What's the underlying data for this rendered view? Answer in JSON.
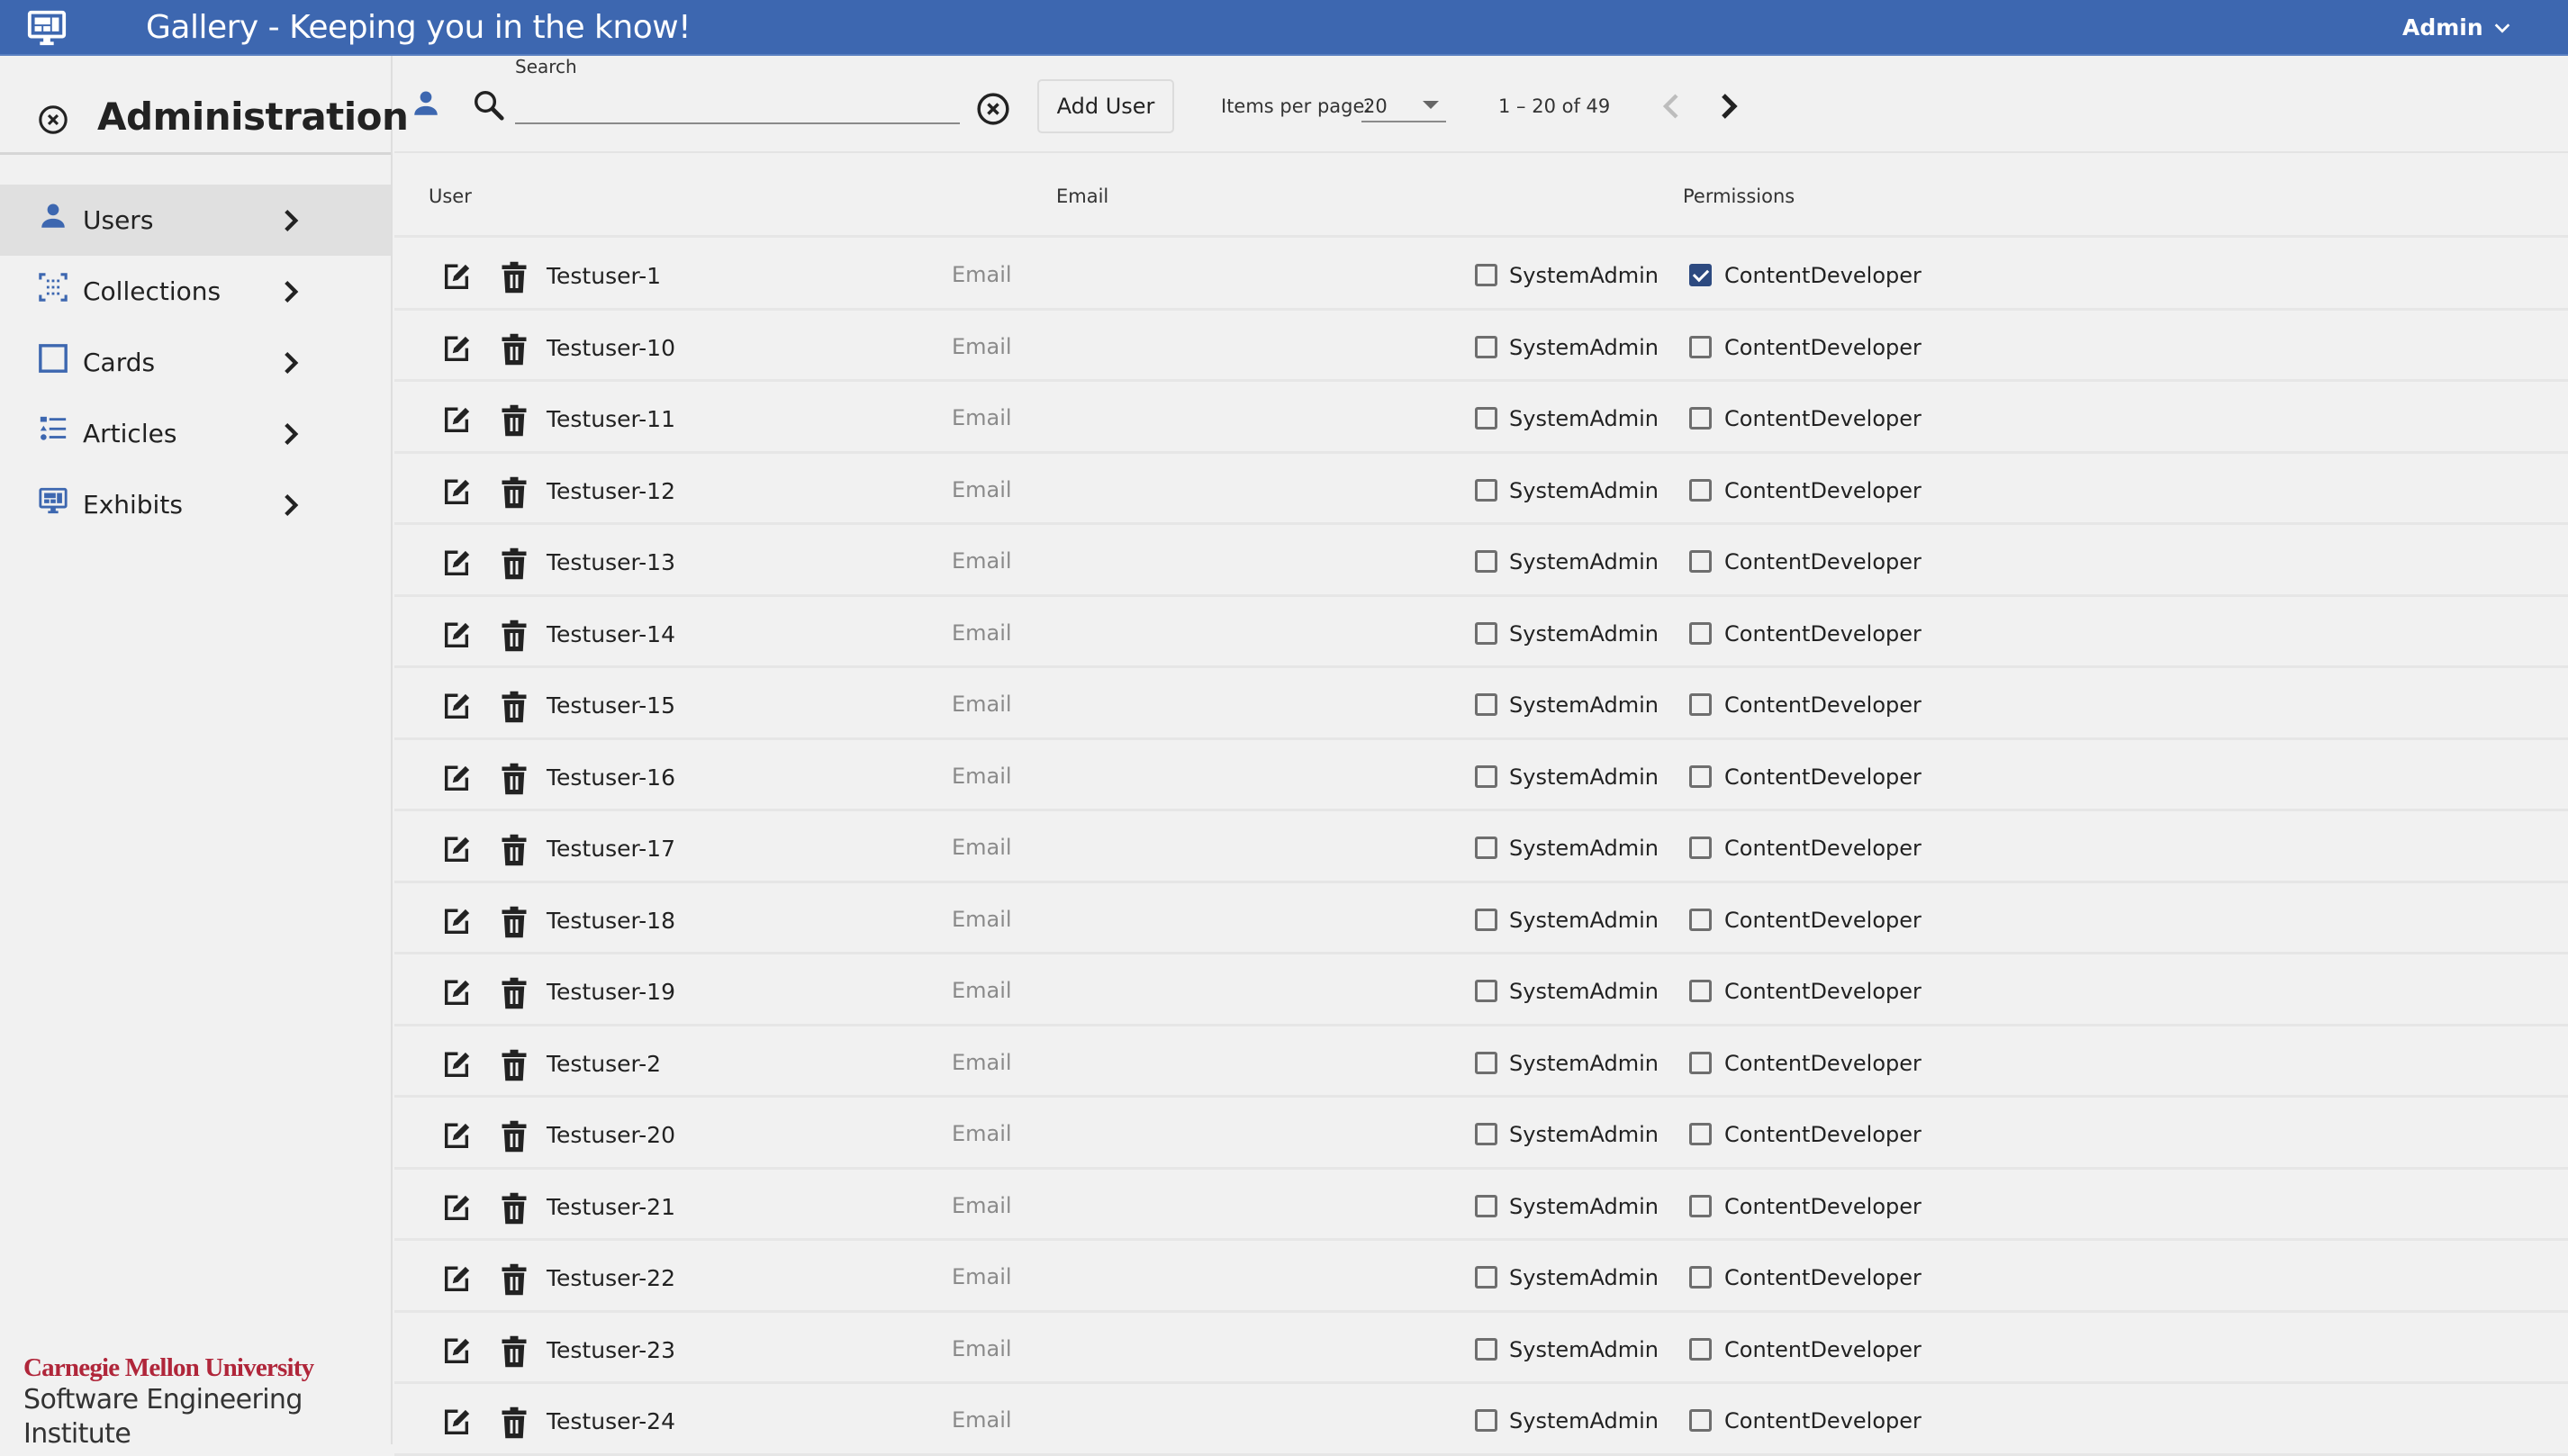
{
  "header": {
    "title": "Gallery - Keeping you in the know!",
    "user_menu": "Admin",
    "logo_icon": "monitor-dashboard-icon",
    "colors": {
      "brand": "#3d67b0"
    }
  },
  "sidebar": {
    "title": "Administration",
    "close_icon": "close-circle-icon",
    "items": [
      {
        "label": "Users",
        "icon": "account-icon",
        "active": true
      },
      {
        "label": "Collections",
        "icon": "collection-grid-icon",
        "active": false
      },
      {
        "label": "Cards",
        "icon": "card-square-icon",
        "active": false
      },
      {
        "label": "Articles",
        "icon": "list-icon",
        "active": false
      },
      {
        "label": "Exhibits",
        "icon": "monitor-dashboard-icon",
        "active": false
      }
    ],
    "footer": {
      "line1": "Carnegie Mellon University",
      "line2": "Software Engineering Institute"
    }
  },
  "toolbar": {
    "search_label": "Search",
    "search_value": "",
    "add_user_label": "Add User",
    "items_per_page_label": "Items per page:",
    "items_per_page_value": "20",
    "range_label": "1 – 20 of 49"
  },
  "table": {
    "columns": {
      "user": "User",
      "email": "Email",
      "permissions": "Permissions"
    },
    "permission_labels": {
      "system_admin": "SystemAdmin",
      "content_developer": "ContentDeveloper"
    },
    "rows": [
      {
        "name": "Testuser-1",
        "email": "Email",
        "system_admin": false,
        "content_developer": true
      },
      {
        "name": "Testuser-10",
        "email": "Email",
        "system_admin": false,
        "content_developer": false
      },
      {
        "name": "Testuser-11",
        "email": "Email",
        "system_admin": false,
        "content_developer": false
      },
      {
        "name": "Testuser-12",
        "email": "Email",
        "system_admin": false,
        "content_developer": false
      },
      {
        "name": "Testuser-13",
        "email": "Email",
        "system_admin": false,
        "content_developer": false
      },
      {
        "name": "Testuser-14",
        "email": "Email",
        "system_admin": false,
        "content_developer": false
      },
      {
        "name": "Testuser-15",
        "email": "Email",
        "system_admin": false,
        "content_developer": false
      },
      {
        "name": "Testuser-16",
        "email": "Email",
        "system_admin": false,
        "content_developer": false
      },
      {
        "name": "Testuser-17",
        "email": "Email",
        "system_admin": false,
        "content_developer": false
      },
      {
        "name": "Testuser-18",
        "email": "Email",
        "system_admin": false,
        "content_developer": false
      },
      {
        "name": "Testuser-19",
        "email": "Email",
        "system_admin": false,
        "content_developer": false
      },
      {
        "name": "Testuser-2",
        "email": "Email",
        "system_admin": false,
        "content_developer": false
      },
      {
        "name": "Testuser-20",
        "email": "Email",
        "system_admin": false,
        "content_developer": false
      },
      {
        "name": "Testuser-21",
        "email": "Email",
        "system_admin": false,
        "content_developer": false
      },
      {
        "name": "Testuser-22",
        "email": "Email",
        "system_admin": false,
        "content_developer": false
      },
      {
        "name": "Testuser-23",
        "email": "Email",
        "system_admin": false,
        "content_developer": false
      },
      {
        "name": "Testuser-24",
        "email": "Email",
        "system_admin": false,
        "content_developer": false
      }
    ]
  }
}
